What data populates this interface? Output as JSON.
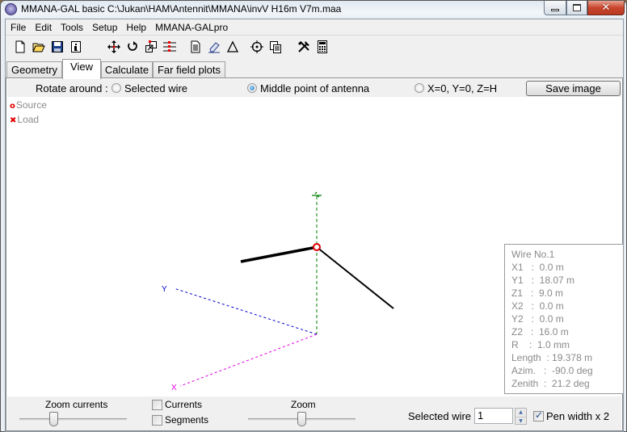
{
  "window": {
    "title": "MMANA-GAL basic C:\\Jukan\\HAM\\Antennit\\MMANA\\invV H16m V7m.maa",
    "controls": {
      "minimize": "minimize",
      "maximize": "maximize",
      "close": "✕"
    }
  },
  "menu": [
    "File",
    "Edit",
    "Tools",
    "Setup",
    "Help",
    "MMANA-GALpro"
  ],
  "toolbar": [
    {
      "icon": "new-file-icon",
      "glyph": "🗋"
    },
    {
      "icon": "open-folder-icon",
      "glyph": "🗁"
    },
    {
      "icon": "save-disk-icon",
      "glyph": "💾"
    },
    {
      "icon": "info-icon",
      "glyph": "ℹ"
    },
    {
      "icon": "move-icon",
      "glyph": "✥"
    },
    {
      "icon": "rotate-icon",
      "glyph": "↻"
    },
    {
      "icon": "resize-icon",
      "glyph": "⧉"
    },
    {
      "icon": "segments-icon",
      "glyph": "☰"
    },
    {
      "icon": "document-icon",
      "glyph": "🗎"
    },
    {
      "icon": "eraser-icon",
      "glyph": "✎"
    },
    {
      "icon": "triangle-icon",
      "glyph": "△"
    },
    {
      "icon": "crosshair-icon",
      "glyph": "⌖"
    },
    {
      "icon": "copy-icon",
      "glyph": "⧉"
    },
    {
      "icon": "tools-icon",
      "glyph": "⚒"
    },
    {
      "icon": "calculator-icon",
      "glyph": "▦"
    }
  ],
  "tabs": [
    {
      "label": "Geometry",
      "active": false
    },
    {
      "label": "View",
      "active": true
    },
    {
      "label": "Calculate",
      "active": false
    },
    {
      "label": "Far field plots",
      "active": false
    }
  ],
  "rotate": {
    "label": "Rotate around :",
    "options": [
      {
        "label": "Selected wire",
        "checked": false
      },
      {
        "label": "Middle point of antenna",
        "checked": true
      },
      {
        "label": "X=0, Y=0, Z=H",
        "checked": false
      }
    ],
    "save_button": "Save image"
  },
  "legend": {
    "source": {
      "marker": "o",
      "label": "Source"
    },
    "load": {
      "marker": "✖",
      "label": "Load"
    }
  },
  "view3d": {
    "axis_labels": {
      "x": "X",
      "y": "Y",
      "z": "Z"
    },
    "colors": {
      "x_axis": "#e000e0",
      "y_axis": "#0000d0",
      "z_axis": "#008000",
      "wire": "#000000",
      "source": "#e00000"
    }
  },
  "wire_info": {
    "lines": [
      "Wire No.1",
      "X1   :  0.0 m",
      "Y1   :  18.07 m",
      "Z1   :  9.0 m",
      "X2   :  0.0 m",
      "Y2   :  0.0 m",
      "Z2   :  16.0 m",
      "R    :  1.0 mm",
      "Length  : 19.378 m",
      "Azim.   :  -90.0 deg",
      "Zenith  :  21.2 deg"
    ]
  },
  "bottom": {
    "zoom_currents_label": "Zoom currents",
    "zoom_currents_value": 0.3,
    "currents_label": "Currents",
    "currents_checked": false,
    "segments_label": "Segments",
    "segments_checked": false,
    "zoom_label": "Zoom",
    "zoom_value": 0.5,
    "selected_wire_label": "Selected wire",
    "selected_wire_value": "1",
    "pen_width_label": "Pen width x 2",
    "pen_width_checked": true
  }
}
